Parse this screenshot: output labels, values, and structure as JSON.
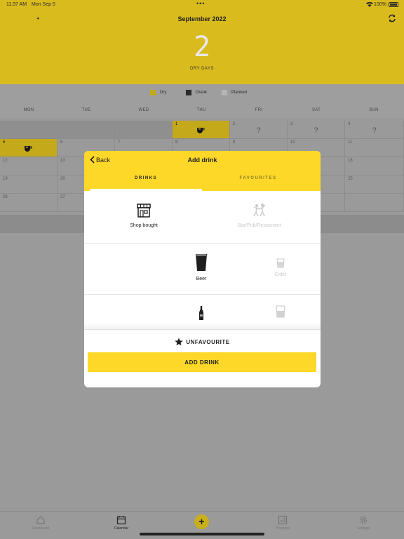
{
  "status_bar": {
    "time": "11:37 AM",
    "date": "Mon Sep 5",
    "dots": "•••",
    "battery": "100%"
  },
  "header": {
    "prev_arrow": "◂",
    "month": "September 2022",
    "dry_count": "2",
    "dry_label": "DRY DAYS",
    "sync_icon": "sync-icon"
  },
  "legend": [
    {
      "label": "Dry",
      "color": "#c4a91b"
    },
    {
      "label": "Drank",
      "color": "#2a2a2a"
    },
    {
      "label": "Planned",
      "color": "#b5b5b5"
    }
  ],
  "weekdays": [
    "MON",
    "TUE",
    "WED",
    "THU",
    "FRI",
    "SAT",
    "SUN"
  ],
  "calendar": {
    "row1": [
      "",
      "",
      "",
      "1",
      "2",
      "3",
      "4"
    ],
    "row2": [
      "5",
      "6",
      "7",
      "8",
      "9",
      "10",
      "11"
    ],
    "row3": [
      "12",
      "13",
      "",
      "",
      "",
      "",
      "18"
    ],
    "row4": [
      "19",
      "20",
      "",
      "",
      "",
      "",
      "25"
    ],
    "row5": [
      "26",
      "27",
      "",
      "",
      "",
      "",
      ""
    ],
    "planned_mark": "?"
  },
  "tabbar": {
    "dashboard": "Dashboard",
    "calendar": "Calendar",
    "add": "+",
    "progress": "Progress",
    "settings": "Settings"
  },
  "modal": {
    "back": "Back",
    "title": "Add drink",
    "tab_drinks": "DRINKS",
    "tab_favourites": "FAVOURITES",
    "venue_options": [
      {
        "label": "Shop bought",
        "icon": "shop-icon",
        "selected": true
      },
      {
        "label": "Bar/Pub/Restaurant",
        "icon": "dancing-people-icon",
        "selected": false
      }
    ],
    "drink_options": [
      {
        "label": "Beer",
        "icon": "pint-glass-icon",
        "selected": true
      },
      {
        "label": "Cider",
        "icon": "cider-glass-icon",
        "selected": false
      }
    ],
    "unfavourite": "UNFAVOURITE",
    "add_drink": "ADD DRINK"
  },
  "colors": {
    "accent": "#fdd828",
    "dim_accent": "#d9bb1e",
    "overlay_grey": "#9a9a9a"
  }
}
